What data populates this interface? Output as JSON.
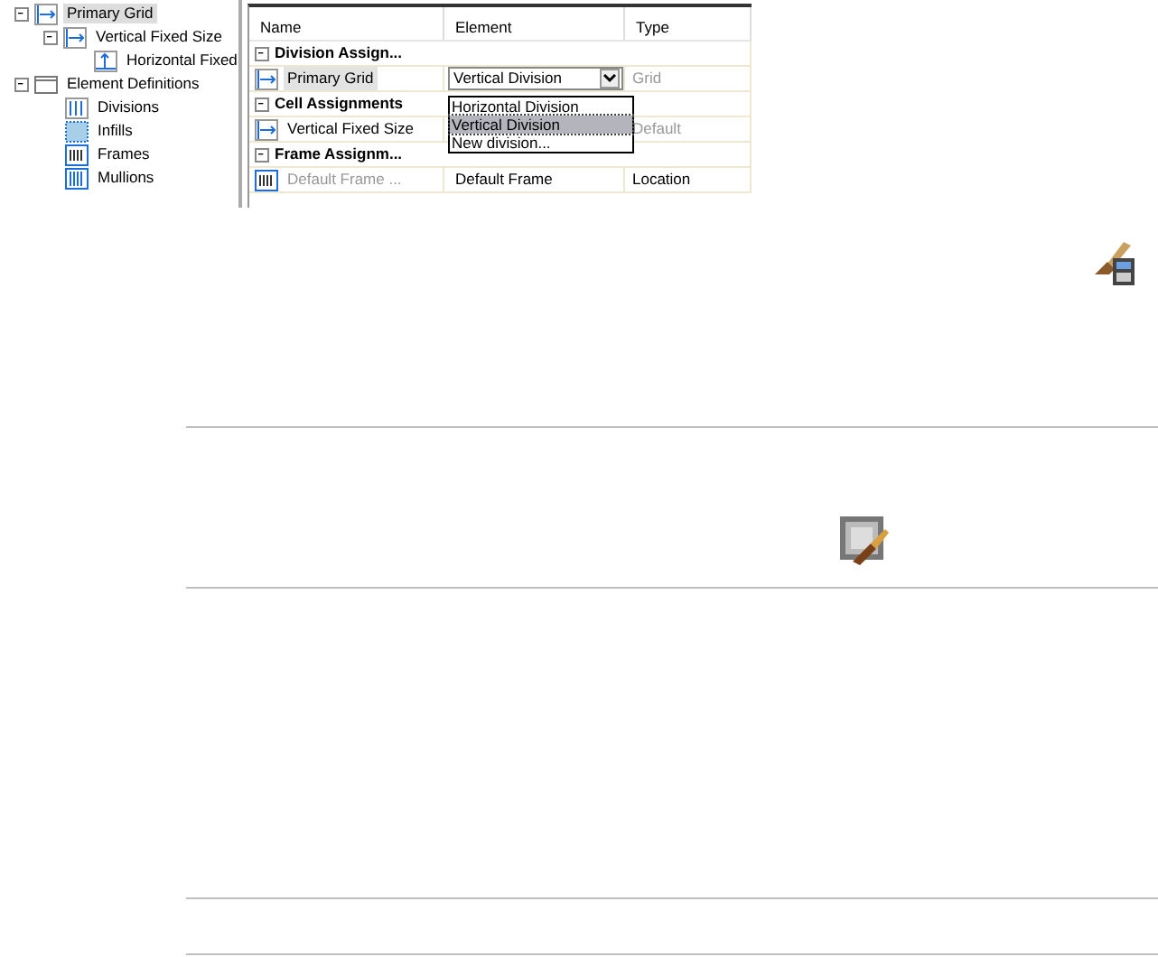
{
  "tree": [
    {
      "label": "Primary Grid",
      "kind": "vertical",
      "selected": true,
      "expanded": true,
      "children": [
        {
          "label": "Vertical Fixed Size",
          "kind": "vertical",
          "selected": false,
          "expanded": true,
          "children": [
            {
              "label": "Horizontal Fixed",
              "kind": "horizontal",
              "selected": false
            }
          ]
        }
      ]
    },
    {
      "label": "Element Definitions",
      "kind": "folder",
      "selected": false,
      "expanded": true,
      "children": [
        {
          "label": "Divisions",
          "kind": "division",
          "selected": false
        },
        {
          "label": "Infills",
          "kind": "infill",
          "selected": false
        },
        {
          "label": "Frames",
          "kind": "frame",
          "selected": false
        },
        {
          "label": "Mullions",
          "kind": "mullion",
          "selected": false
        }
      ]
    }
  ],
  "table": {
    "columns": [
      "Name",
      "Element",
      "Type"
    ],
    "rows": [
      {
        "kind": "group",
        "name": "Division Assign...",
        "expanded": true
      },
      {
        "kind": "grid",
        "name": "Primary Grid",
        "selected": true,
        "name_disabled": false,
        "type": "Grid",
        "type_disabled": true,
        "dropdown": {
          "value": "Vertical Division",
          "options": [
            {
              "label": "Horizontal Division",
              "selected": false
            },
            {
              "label": "Vertical Division",
              "selected": true
            },
            {
              "label": "New division...",
              "selected": false
            }
          ]
        }
      },
      {
        "kind": "group",
        "name": "Cell Assignments",
        "expanded": true
      },
      {
        "kind": "grid",
        "name": "Vertical Fixed Size",
        "selected": false,
        "name_disabled": false,
        "type": "Default",
        "type_disabled": true
      },
      {
        "kind": "group",
        "name": "Frame Assignm...",
        "expanded": true
      },
      {
        "kind": "frame",
        "name": "Default Frame ...",
        "selected": false,
        "name_disabled": true,
        "element": "Default Frame",
        "type": "Location",
        "type_disabled": false
      }
    ]
  }
}
